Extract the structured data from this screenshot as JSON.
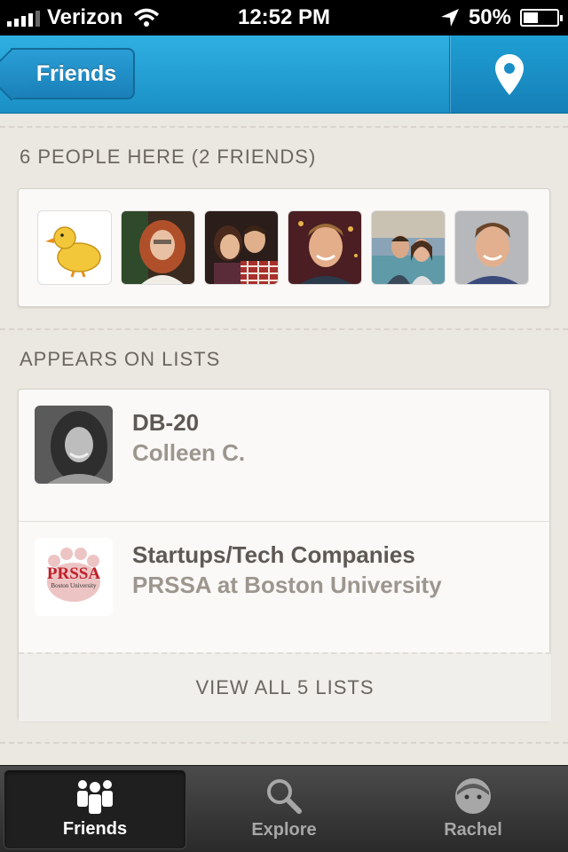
{
  "status_bar": {
    "carrier": "Verizon",
    "time": "12:52 PM",
    "battery": "50%",
    "battery_level": 0.5
  },
  "nav": {
    "back_label": "Friends",
    "map_icon": "location-pin-icon"
  },
  "people_section": {
    "header": "6 PEOPLE HERE (2 FRIENDS)",
    "avatars": [
      "duck",
      "person",
      "couple",
      "person",
      "couple",
      "person"
    ]
  },
  "lists_section": {
    "header": "APPEARS ON LISTS",
    "items": [
      {
        "title": "DB-20",
        "owner": "Colleen C."
      },
      {
        "title": "Startups/Tech Companies",
        "owner": "PRSSA at Boston University",
        "logo_text": "PRSSA",
        "logo_subtext": "Boston University"
      }
    ],
    "view_all": "VIEW ALL 5 LISTS"
  },
  "tab_bar": {
    "tabs": [
      {
        "label": "Friends",
        "icon": "friends-icon",
        "active": true
      },
      {
        "label": "Explore",
        "icon": "search-icon",
        "active": false
      },
      {
        "label": "Rachel",
        "icon": "profile-icon",
        "active": false
      }
    ]
  },
  "colors": {
    "nav_blue": "#1f9bd6",
    "background": "#ebe7e1",
    "tab_bar": "#2f2f2f"
  }
}
